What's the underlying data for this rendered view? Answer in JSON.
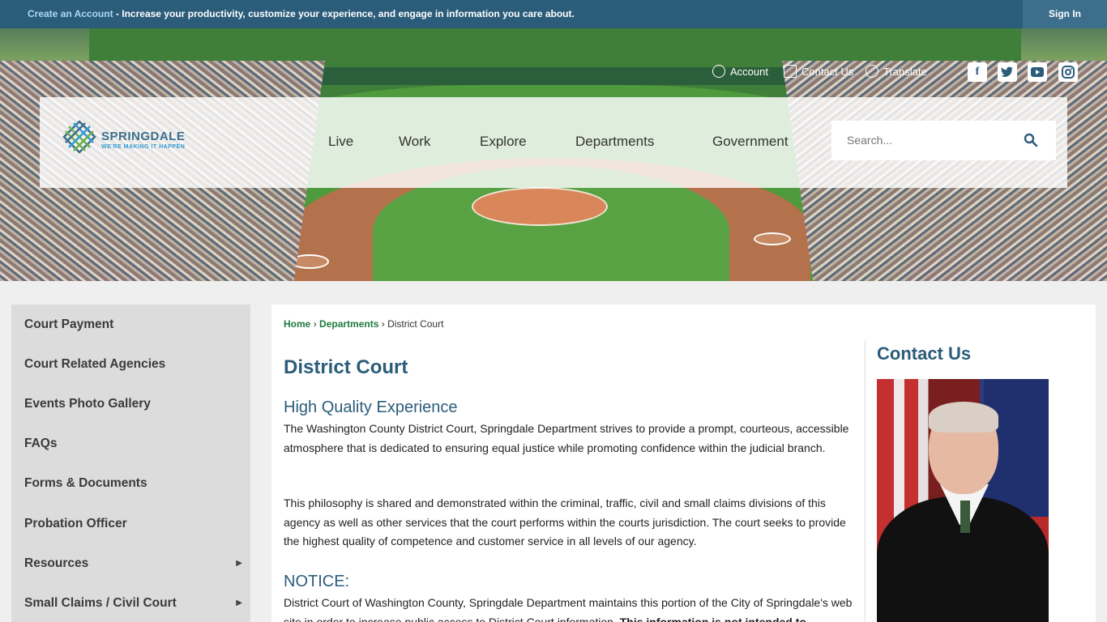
{
  "topbar": {
    "create_link": "Create an Account",
    "message": " - Increase your productivity, customize your experience, and engage in information you care about.",
    "signin": "Sign In"
  },
  "utility": {
    "account": "Account",
    "contact": "Contact Us",
    "translate": "Translate"
  },
  "social": [
    "facebook-icon",
    "twitter-icon",
    "youtube-icon",
    "instagram-icon"
  ],
  "logo": {
    "name": "SPRINGDALE",
    "tagline": "WE'RE MAKING IT HAPPEN"
  },
  "nav": [
    "Live",
    "Work",
    "Explore",
    "Departments",
    "Government"
  ],
  "search": {
    "placeholder": "Search..."
  },
  "sidebar": [
    {
      "label": "Court Payment",
      "has_submenu": false
    },
    {
      "label": "Court Related Agencies",
      "has_submenu": false
    },
    {
      "label": "Events Photo Gallery",
      "has_submenu": false
    },
    {
      "label": "FAQs",
      "has_submenu": false
    },
    {
      "label": "Forms & Documents",
      "has_submenu": false
    },
    {
      "label": "Probation Officer",
      "has_submenu": false
    },
    {
      "label": "Resources",
      "has_submenu": true
    },
    {
      "label": "Small Claims / Civil Court",
      "has_submenu": true
    }
  ],
  "breadcrumb": {
    "home": "Home",
    "sep1": "›",
    "departments": "Departments",
    "sep2": "›",
    "current": "District Court"
  },
  "content": {
    "title": "District Court",
    "heading1": "High Quality Experience",
    "para1": "The Washington County District Court, Springdale Department strives to provide a prompt, courteous, accessible atmosphere that is dedicated to ensuring equal justice while promoting confidence within the judicial branch.",
    "para2": "This philosophy is shared and demonstrated within the criminal, traffic, civil and small claims divisions of this agency as well as other services that the court performs within the courts jurisdiction. The court seeks to provide the highest quality of competence and customer service in all levels of our agency.",
    "heading2": "NOTICE:",
    "para3": "District Court of Washington County, Springdale Department maintains this portion of the City of Springdale's web site in order to increase public access to District Court information.",
    "para3_bold": " This information is not intended to"
  },
  "contact": {
    "title": "Contact Us"
  },
  "colors": {
    "brand": "#2b5c7a",
    "link": "#1d7a3d",
    "sidebar": "#dcdcdc"
  }
}
